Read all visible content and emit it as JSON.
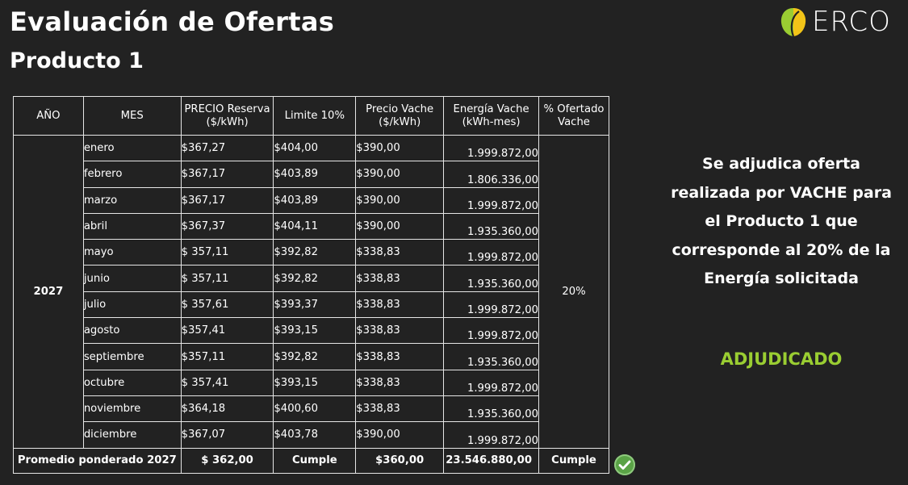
{
  "header": {
    "title": "Evaluación de Ofertas",
    "subtitle": "Producto 1",
    "logo_text": "ERCO",
    "logo_icon": "leaf-circle-icon",
    "logo_colors": [
      "#9acd32",
      "#f2c418"
    ]
  },
  "table": {
    "columns": [
      "AÑO",
      "MES",
      "PRECIO Reserva\n($/kWh)",
      "Limite 10%",
      "Precio Vache\n($/kWh)",
      "Energía Vache\n(kWh-mes)",
      "% Ofertado\nVache"
    ],
    "year": "2027",
    "percent_offered": "20%",
    "rows": [
      {
        "mes": "enero",
        "reserva": "$367,27",
        "limite": "$404,00",
        "vache": "$390,00",
        "energia": "1.999.872,00"
      },
      {
        "mes": "febrero",
        "reserva": "$367,17",
        "limite": "$403,89",
        "vache": "$390,00",
        "energia": "1.806.336,00"
      },
      {
        "mes": "marzo",
        "reserva": "$367,17",
        "limite": "$403,89",
        "vache": "$390,00",
        "energia": "1.999.872,00"
      },
      {
        "mes": "abril",
        "reserva": "$367,37",
        "limite": "$404,11",
        "vache": "$390,00",
        "energia": "1.935.360,00"
      },
      {
        "mes": "mayo",
        "reserva": "$ 357,11",
        "limite": "$392,82",
        "vache": "$338,83",
        "energia": "1.999.872,00"
      },
      {
        "mes": "junio",
        "reserva": "$ 357,11",
        "limite": "$392,82",
        "vache": "$338,83",
        "energia": "1.935.360,00"
      },
      {
        "mes": "julio",
        "reserva": "$ 357,61",
        "limite": "$393,37",
        "vache": "$338,83",
        "energia": "1.999.872,00"
      },
      {
        "mes": "agosto",
        "reserva": "$357,41",
        "limite": "$393,15",
        "vache": "$338,83",
        "energia": "1.999.872,00"
      },
      {
        "mes": "septiembre",
        "reserva": "$357,11",
        "limite": "$392,82",
        "vache": "$338,83",
        "energia": "1.935.360,00"
      },
      {
        "mes": "octubre",
        "reserva": "$ 357,41",
        "limite": "$393,15",
        "vache": "$338,83",
        "energia": "1.999.872,00"
      },
      {
        "mes": "noviembre",
        "reserva": "$364,18",
        "limite": "$400,60",
        "vache": "$338,83",
        "energia": "1.935.360,00"
      },
      {
        "mes": "diciembre",
        "reserva": "$367,07",
        "limite": "$403,78",
        "vache": "$390,00",
        "energia": "1.999.872,00"
      }
    ],
    "footer": {
      "label": "Promedio ponderado 2027",
      "reserva": "$ 362,00",
      "limite": "Cumple",
      "vache": "$360,00",
      "energia": "23.546.880,00",
      "pct": "Cumple"
    },
    "status_icon": "check-circle-icon",
    "status_color": "#5aa346"
  },
  "side": {
    "message": "Se adjudica oferta realizada por VACHE para el Producto 1 que corresponde al 20% de la Energía solicitada",
    "status": "ADJUDICADO",
    "status_color": "#9acd32"
  }
}
